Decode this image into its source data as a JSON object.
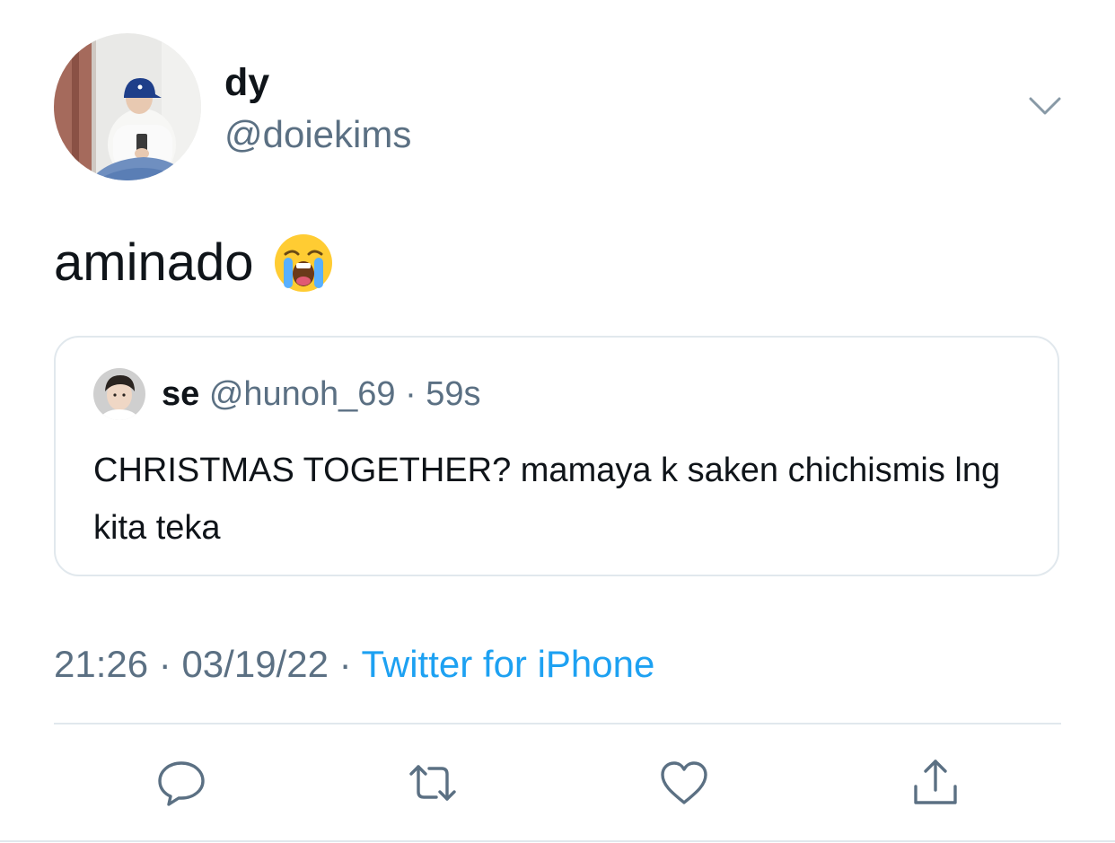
{
  "tweet": {
    "author": {
      "display_name": "dy",
      "handle": "@doiekims"
    },
    "text": "aminado",
    "emoji": "loudly-crying-face",
    "quoted": {
      "display_name": "se",
      "handle": "@hunoh_69",
      "separator": "·",
      "time": "59s",
      "text": "CHRISTMAS TOGETHER? mamaya k saken chichismis lng kita teka"
    },
    "time": "21:26",
    "date": "03/19/22",
    "separator": "·",
    "source": "Twitter for iPhone"
  },
  "icons": {
    "menu": "chevron-down-icon",
    "reply": "reply-icon",
    "retweet": "retweet-icon",
    "like": "heart-icon",
    "share": "share-icon"
  },
  "colors": {
    "text": "#0f1419",
    "secondary": "#5b7083",
    "link": "#1da1f2",
    "border": "#e1e8ed"
  }
}
